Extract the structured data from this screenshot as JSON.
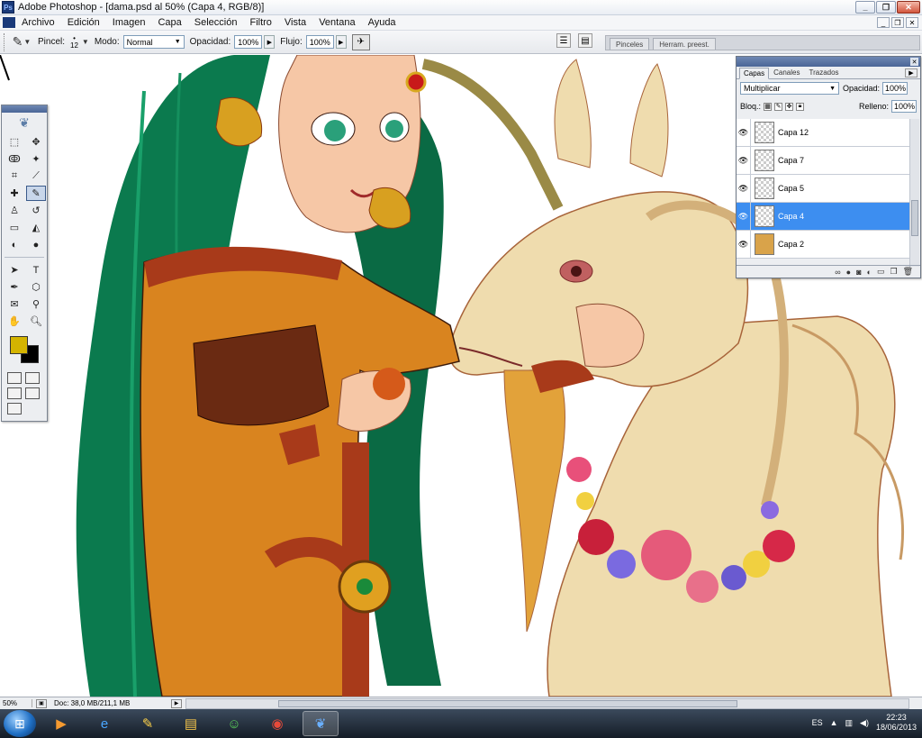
{
  "window": {
    "title": "Adobe Photoshop - [dama.psd al 50% (Capa 4, RGB/8)]",
    "app_icon_text": "Ps",
    "controls": [
      "_",
      "❐",
      "✕"
    ]
  },
  "menu": [
    "Archivo",
    "Edición",
    "Imagen",
    "Capa",
    "Selección",
    "Filtro",
    "Vista",
    "Ventana",
    "Ayuda"
  ],
  "options": {
    "brush_label": "Pincel:",
    "brush_size": "12",
    "mode_label": "Modo:",
    "mode_value": "Normal",
    "opacity_label": "Opacidad:",
    "opacity_value": "100%",
    "flow_label": "Flujo:",
    "flow_value": "100%",
    "well_tabs": [
      "Pinceles",
      "Herram. preest."
    ]
  },
  "layers_panel": {
    "tabs": [
      "Capas",
      "Canales",
      "Trazados"
    ],
    "blend_mode": "Multiplicar",
    "opacity_label": "Opacidad:",
    "opacity_value": "100%",
    "lock_label": "Bloq.:",
    "fill_label": "Relleno:",
    "fill_value": "100%",
    "layers": [
      {
        "name": "Capa 12",
        "selected": false
      },
      {
        "name": "Capa 7",
        "selected": false
      },
      {
        "name": "Capa 5",
        "selected": false
      },
      {
        "name": "Capa 4",
        "selected": true
      },
      {
        "name": "Capa 2",
        "selected": false
      }
    ],
    "footer_icons": [
      "link-icon",
      "fx-icon",
      "mask-icon",
      "adjustment-icon",
      "group-icon",
      "new-layer-icon",
      "trash-icon"
    ]
  },
  "toolbox": {
    "foreground_color": "#d4b400",
    "background_color": "#000000"
  },
  "status": {
    "zoom": "50%",
    "doc_info": "Doc: 38,0 MB/211,1 MB"
  },
  "taskbar": {
    "language": "ES",
    "time": "22:23",
    "date": "18/06/2013"
  },
  "colors": {
    "selection_blue": "#3d8ef0",
    "panel_bg": "#eceef1",
    "hair_green": "#0b7a4e",
    "dress_orange": "#d9841f",
    "unicorn_cream": "#efdcae"
  }
}
